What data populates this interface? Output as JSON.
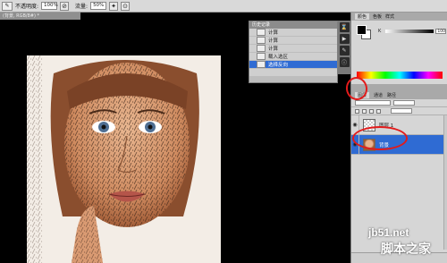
{
  "options_bar": {
    "opacity_label": "不透明度:",
    "opacity_value": "100%",
    "flow_label": "流量:",
    "flow_value": "50%"
  },
  "document": {
    "tab_label": "(背景, RGB/8#) *"
  },
  "history": {
    "title": "历史记录",
    "items": [
      {
        "label": "计算",
        "selected": false
      },
      {
        "label": "计算",
        "selected": false
      },
      {
        "label": "计算",
        "selected": false
      },
      {
        "label": "载入选区",
        "selected": false
      },
      {
        "label": "选择反向",
        "selected": true
      }
    ]
  },
  "color_panel": {
    "tabs": [
      "颜色",
      "色板",
      "样式"
    ],
    "sliders": [
      {
        "label": "K",
        "value": "100"
      }
    ],
    "foreground": "#000000",
    "background": "#ffffff"
  },
  "layers_panel": {
    "tabs": [
      "图层",
      "通道",
      "路径"
    ],
    "layers": [
      {
        "name": "图层 1",
        "thumb": "checker",
        "selected": false
      },
      {
        "name": "背景",
        "thumb": "photo",
        "selected": true
      }
    ]
  },
  "watermark": {
    "line1": "jb51.net",
    "line2": "脚本之家"
  },
  "colors": {
    "selection": "#2f6bd3",
    "annotation": "#e21b1b"
  }
}
